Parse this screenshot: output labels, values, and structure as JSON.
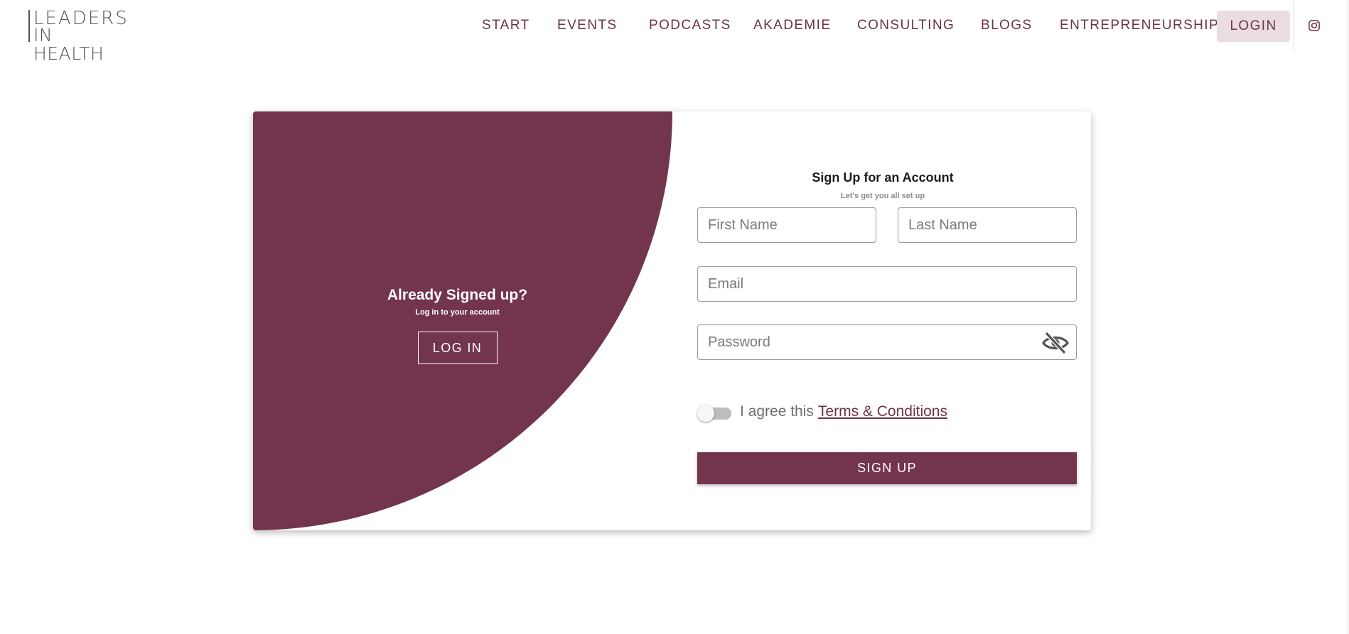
{
  "header": {
    "logo": {
      "line1": "LEADERS",
      "line2": "IN HEALTH"
    },
    "nav": [
      "START",
      "EVENTS",
      "PODCASTS",
      "AKADEMIE",
      "CONSULTING",
      "BLOGS",
      "ENTREPRENEURSHIP"
    ],
    "login_label": "LOGIN",
    "social_icon": "instagram-icon"
  },
  "left_panel": {
    "title": "Already Signed up?",
    "subtitle": "Log in to your account",
    "button_label": "LOG IN"
  },
  "form": {
    "title": "Sign Up for an Account",
    "subtitle": "Let's get you all set up",
    "first_name_placeholder": "First Name",
    "last_name_placeholder": "Last Name",
    "email_placeholder": "Email",
    "password_placeholder": "Password",
    "password_icon": "eye-off-icon",
    "agree_text": "I agree this",
    "terms_link": "Terms & Conditions",
    "agree_checked": false,
    "submit_label": "SIGN UP"
  },
  "colors": {
    "brand": "#73344d",
    "nav_text": "#6e3149",
    "login_bg": "#e9dde2"
  }
}
